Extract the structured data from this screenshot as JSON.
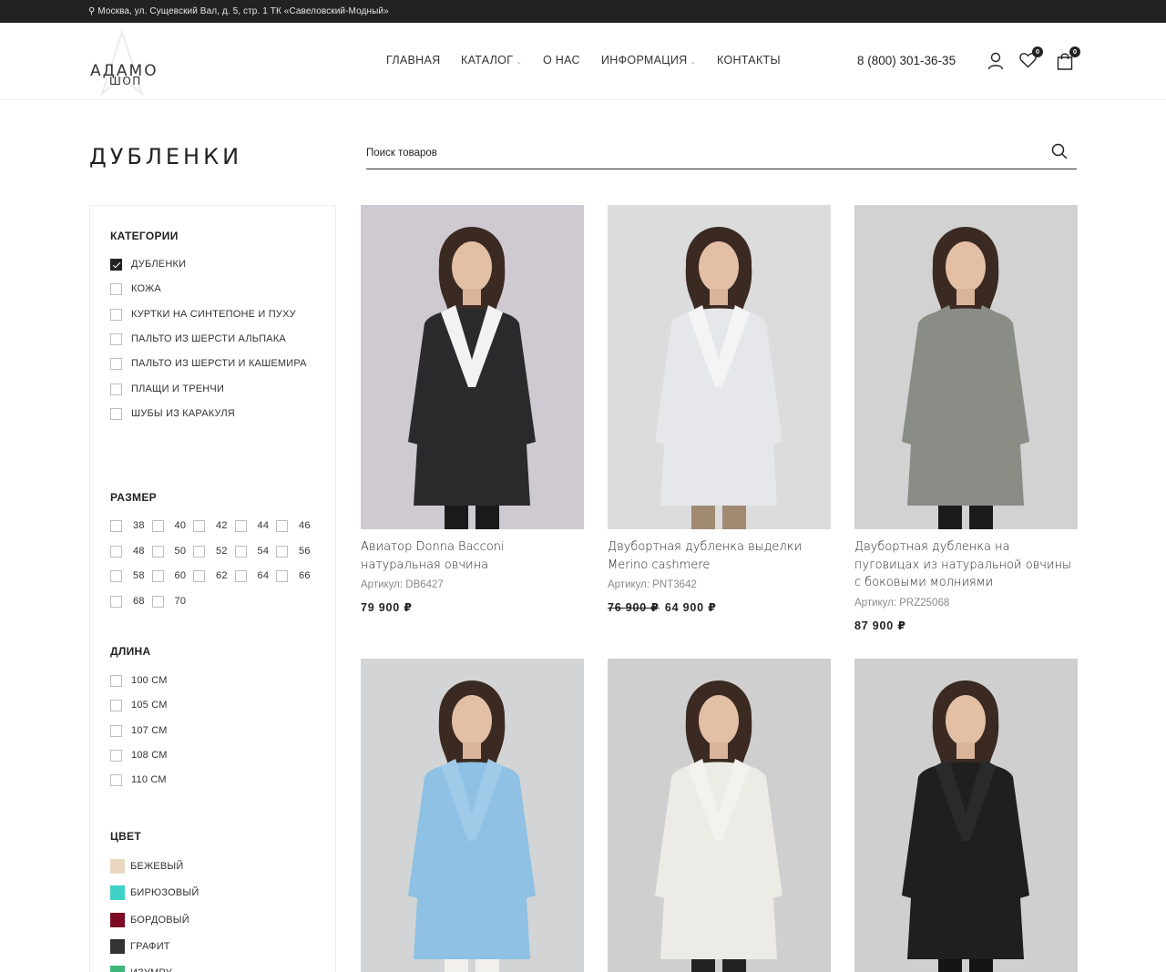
{
  "topbar": {
    "address": "⚲ Москва, ул. Сущевский Вал, д. 5, стр. 1 ТК «Савеловский-Модный»"
  },
  "logo": {
    "line1": "АДАМО",
    "line2": "ШОП"
  },
  "nav": {
    "items": [
      {
        "label": "ГЛАВНАЯ",
        "dropdown": false
      },
      {
        "label": "КАТАЛОГ",
        "dropdown": true
      },
      {
        "label": "О НАС",
        "dropdown": false
      },
      {
        "label": "ИНФОРМАЦИЯ",
        "dropdown": true
      },
      {
        "label": "КОНТАКТЫ",
        "dropdown": false
      }
    ]
  },
  "header": {
    "phone": "8 (800) 301-36-35",
    "wishlist_count": "0",
    "cart_count": "0"
  },
  "page": {
    "title": "ДУБЛЕНКИ"
  },
  "search": {
    "placeholder": "Поиск товаров"
  },
  "filters": {
    "categories": {
      "title": "КАТЕГОРИИ",
      "items": [
        {
          "label": "ДУБЛЕНКИ",
          "checked": true
        },
        {
          "label": "КОЖА",
          "checked": false
        },
        {
          "label": "КУРТКИ НА СИНТЕПОНЕ И ПУХУ",
          "checked": false
        },
        {
          "label": "ПАЛЬТО ИЗ ШЕРСТИ АЛЬПАКА",
          "checked": false
        },
        {
          "label": "ПАЛЬТО ИЗ ШЕРСТИ И КАШЕМИРА",
          "checked": false
        },
        {
          "label": "ПЛАЩИ И ТРЕНЧИ",
          "checked": false
        },
        {
          "label": "ШУБЫ ИЗ КАРАКУЛЯ",
          "checked": false
        }
      ]
    },
    "sizes": {
      "title": "РАЗМЕР",
      "items": [
        "38",
        "40",
        "42",
        "44",
        "46",
        "48",
        "50",
        "52",
        "54",
        "56",
        "58",
        "60",
        "62",
        "64",
        "66",
        "68",
        "70"
      ]
    },
    "lengths": {
      "title": "ДЛИНА",
      "items": [
        "100 СМ",
        "105 СМ",
        "107 СМ",
        "108 СМ",
        "110 СМ"
      ]
    },
    "colors": {
      "title": "ЦВЕТ",
      "items": [
        {
          "label": "БЕЖЕВЫЙ",
          "color": "#e8d8c0"
        },
        {
          "label": "БИРЮЗОВЫЙ",
          "color": "#3fd1c8"
        },
        {
          "label": "БОРДОВЫЙ",
          "color": "#7c0a24"
        },
        {
          "label": "ГРАФИТ",
          "color": "#333333"
        },
        {
          "label": "ИЗУМРУ",
          "color": "#3db87a"
        }
      ]
    }
  },
  "products": [
    {
      "name": "Авиатор Donna Bacconi натуральная овчина",
      "sku": "Артикул: DB6427",
      "old_price": "",
      "price": "79 900 ₽",
      "bg": "#cfcad2",
      "coat": "#2a2a2c",
      "trim": "#f2f2f2",
      "pants": "#1a1a1a"
    },
    {
      "name": "Двубортная дубленка выделки Merino cashmere",
      "sku": "Артикул: PNT3642",
      "old_price": "76 900 ₽",
      "price": "64 900 ₽",
      "bg": "#dcdcdc",
      "coat": "#e6e7ea",
      "trim": "#f4f4f5",
      "pants": "#a08a72"
    },
    {
      "name": "Двубортная дубленка на пуговицах из натуральной овчины с боковыми молниями",
      "sku": "Артикул: PRZ25068",
      "old_price": "",
      "price": "87 900 ₽",
      "bg": "#d2d2d2",
      "coat": "#8a8c86",
      "trim": "#8a8c86",
      "pants": "#1b1b1b"
    },
    {
      "name": "",
      "sku": "",
      "old_price": "",
      "price": "",
      "bg": "#d3d4d6",
      "coat": "#8ec1e3",
      "trim": "#9fcbe8",
      "pants": "#f2f0ec"
    },
    {
      "name": "",
      "sku": "",
      "old_price": "",
      "price": "",
      "bg": "#cfcfcf",
      "coat": "#ecebe6",
      "trim": "#f3f2ee",
      "pants": "#222222"
    },
    {
      "name": "",
      "sku": "",
      "old_price": "",
      "price": "",
      "bg": "#cfcfcf",
      "coat": "#1f1f1f",
      "trim": "#2a2a2a",
      "pants": "#151515"
    }
  ]
}
